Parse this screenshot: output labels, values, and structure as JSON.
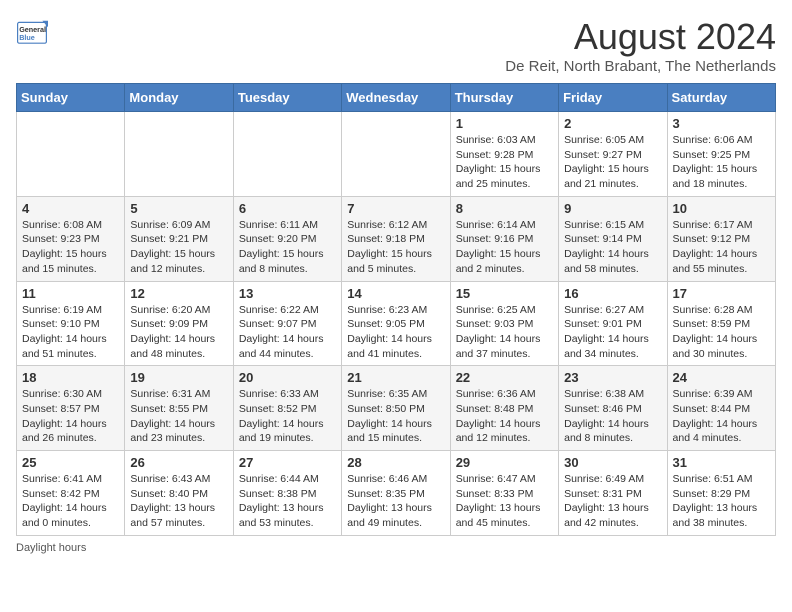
{
  "header": {
    "logo_line1": "General",
    "logo_line2": "Blue",
    "title": "August 2024",
    "subtitle": "De Reit, North Brabant, The Netherlands"
  },
  "weekdays": [
    "Sunday",
    "Monday",
    "Tuesday",
    "Wednesday",
    "Thursday",
    "Friday",
    "Saturday"
  ],
  "weeks": [
    [
      {
        "day": "",
        "detail": ""
      },
      {
        "day": "",
        "detail": ""
      },
      {
        "day": "",
        "detail": ""
      },
      {
        "day": "",
        "detail": ""
      },
      {
        "day": "1",
        "detail": "Sunrise: 6:03 AM\nSunset: 9:28 PM\nDaylight: 15 hours and 25 minutes."
      },
      {
        "day": "2",
        "detail": "Sunrise: 6:05 AM\nSunset: 9:27 PM\nDaylight: 15 hours and 21 minutes."
      },
      {
        "day": "3",
        "detail": "Sunrise: 6:06 AM\nSunset: 9:25 PM\nDaylight: 15 hours and 18 minutes."
      }
    ],
    [
      {
        "day": "4",
        "detail": "Sunrise: 6:08 AM\nSunset: 9:23 PM\nDaylight: 15 hours and 15 minutes."
      },
      {
        "day": "5",
        "detail": "Sunrise: 6:09 AM\nSunset: 9:21 PM\nDaylight: 15 hours and 12 minutes."
      },
      {
        "day": "6",
        "detail": "Sunrise: 6:11 AM\nSunset: 9:20 PM\nDaylight: 15 hours and 8 minutes."
      },
      {
        "day": "7",
        "detail": "Sunrise: 6:12 AM\nSunset: 9:18 PM\nDaylight: 15 hours and 5 minutes."
      },
      {
        "day": "8",
        "detail": "Sunrise: 6:14 AM\nSunset: 9:16 PM\nDaylight: 15 hours and 2 minutes."
      },
      {
        "day": "9",
        "detail": "Sunrise: 6:15 AM\nSunset: 9:14 PM\nDaylight: 14 hours and 58 minutes."
      },
      {
        "day": "10",
        "detail": "Sunrise: 6:17 AM\nSunset: 9:12 PM\nDaylight: 14 hours and 55 minutes."
      }
    ],
    [
      {
        "day": "11",
        "detail": "Sunrise: 6:19 AM\nSunset: 9:10 PM\nDaylight: 14 hours and 51 minutes."
      },
      {
        "day": "12",
        "detail": "Sunrise: 6:20 AM\nSunset: 9:09 PM\nDaylight: 14 hours and 48 minutes."
      },
      {
        "day": "13",
        "detail": "Sunrise: 6:22 AM\nSunset: 9:07 PM\nDaylight: 14 hours and 44 minutes."
      },
      {
        "day": "14",
        "detail": "Sunrise: 6:23 AM\nSunset: 9:05 PM\nDaylight: 14 hours and 41 minutes."
      },
      {
        "day": "15",
        "detail": "Sunrise: 6:25 AM\nSunset: 9:03 PM\nDaylight: 14 hours and 37 minutes."
      },
      {
        "day": "16",
        "detail": "Sunrise: 6:27 AM\nSunset: 9:01 PM\nDaylight: 14 hours and 34 minutes."
      },
      {
        "day": "17",
        "detail": "Sunrise: 6:28 AM\nSunset: 8:59 PM\nDaylight: 14 hours and 30 minutes."
      }
    ],
    [
      {
        "day": "18",
        "detail": "Sunrise: 6:30 AM\nSunset: 8:57 PM\nDaylight: 14 hours and 26 minutes."
      },
      {
        "day": "19",
        "detail": "Sunrise: 6:31 AM\nSunset: 8:55 PM\nDaylight: 14 hours and 23 minutes."
      },
      {
        "day": "20",
        "detail": "Sunrise: 6:33 AM\nSunset: 8:52 PM\nDaylight: 14 hours and 19 minutes."
      },
      {
        "day": "21",
        "detail": "Sunrise: 6:35 AM\nSunset: 8:50 PM\nDaylight: 14 hours and 15 minutes."
      },
      {
        "day": "22",
        "detail": "Sunrise: 6:36 AM\nSunset: 8:48 PM\nDaylight: 14 hours and 12 minutes."
      },
      {
        "day": "23",
        "detail": "Sunrise: 6:38 AM\nSunset: 8:46 PM\nDaylight: 14 hours and 8 minutes."
      },
      {
        "day": "24",
        "detail": "Sunrise: 6:39 AM\nSunset: 8:44 PM\nDaylight: 14 hours and 4 minutes."
      }
    ],
    [
      {
        "day": "25",
        "detail": "Sunrise: 6:41 AM\nSunset: 8:42 PM\nDaylight: 14 hours and 0 minutes."
      },
      {
        "day": "26",
        "detail": "Sunrise: 6:43 AM\nSunset: 8:40 PM\nDaylight: 13 hours and 57 minutes."
      },
      {
        "day": "27",
        "detail": "Sunrise: 6:44 AM\nSunset: 8:38 PM\nDaylight: 13 hours and 53 minutes."
      },
      {
        "day": "28",
        "detail": "Sunrise: 6:46 AM\nSunset: 8:35 PM\nDaylight: 13 hours and 49 minutes."
      },
      {
        "day": "29",
        "detail": "Sunrise: 6:47 AM\nSunset: 8:33 PM\nDaylight: 13 hours and 45 minutes."
      },
      {
        "day": "30",
        "detail": "Sunrise: 6:49 AM\nSunset: 8:31 PM\nDaylight: 13 hours and 42 minutes."
      },
      {
        "day": "31",
        "detail": "Sunrise: 6:51 AM\nSunset: 8:29 PM\nDaylight: 13 hours and 38 minutes."
      }
    ]
  ],
  "footer": "Daylight hours"
}
